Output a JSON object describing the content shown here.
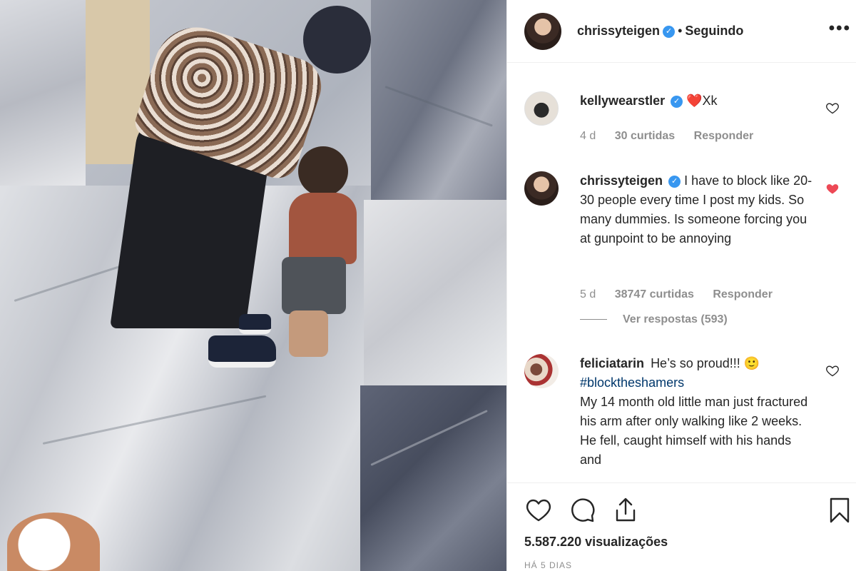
{
  "post": {
    "author": "chrissyteigen",
    "separator": "•",
    "follow_status": "Seguindo",
    "more_label": "•••"
  },
  "comments": [
    {
      "user": "kellywearstler",
      "verified": true,
      "text": "❤️Xk",
      "age": "4 d",
      "likes": "30 curtidas",
      "reply": "Responder",
      "liked": false
    },
    {
      "user": "chrissyteigen",
      "verified": true,
      "text": "I have to block like 20-30 people every time I post my kids. So many dummies. Is someone forcing you at gunpoint to be annoying",
      "age": "5 d",
      "likes": "38747 curtidas",
      "reply": "Responder",
      "view_replies": "Ver respostas (593)",
      "liked": true
    },
    {
      "user": "feliciatarin",
      "verified": false,
      "text": "He’s so proud!!! 🙂",
      "hashtag": "#blocktheshamers",
      "text2": "My 14 month old little man just fractured his arm after only walking like 2 weeks. He fell, caught himself with his hands and",
      "liked": false
    }
  ],
  "stats": {
    "views": "5.587.220 visualizações",
    "time": "HÁ 5 DIAS"
  },
  "colors": {
    "liked": "#ed4956",
    "verified": "#3897f0",
    "hashtag": "#00376b",
    "muted": "#8e8e8e"
  }
}
